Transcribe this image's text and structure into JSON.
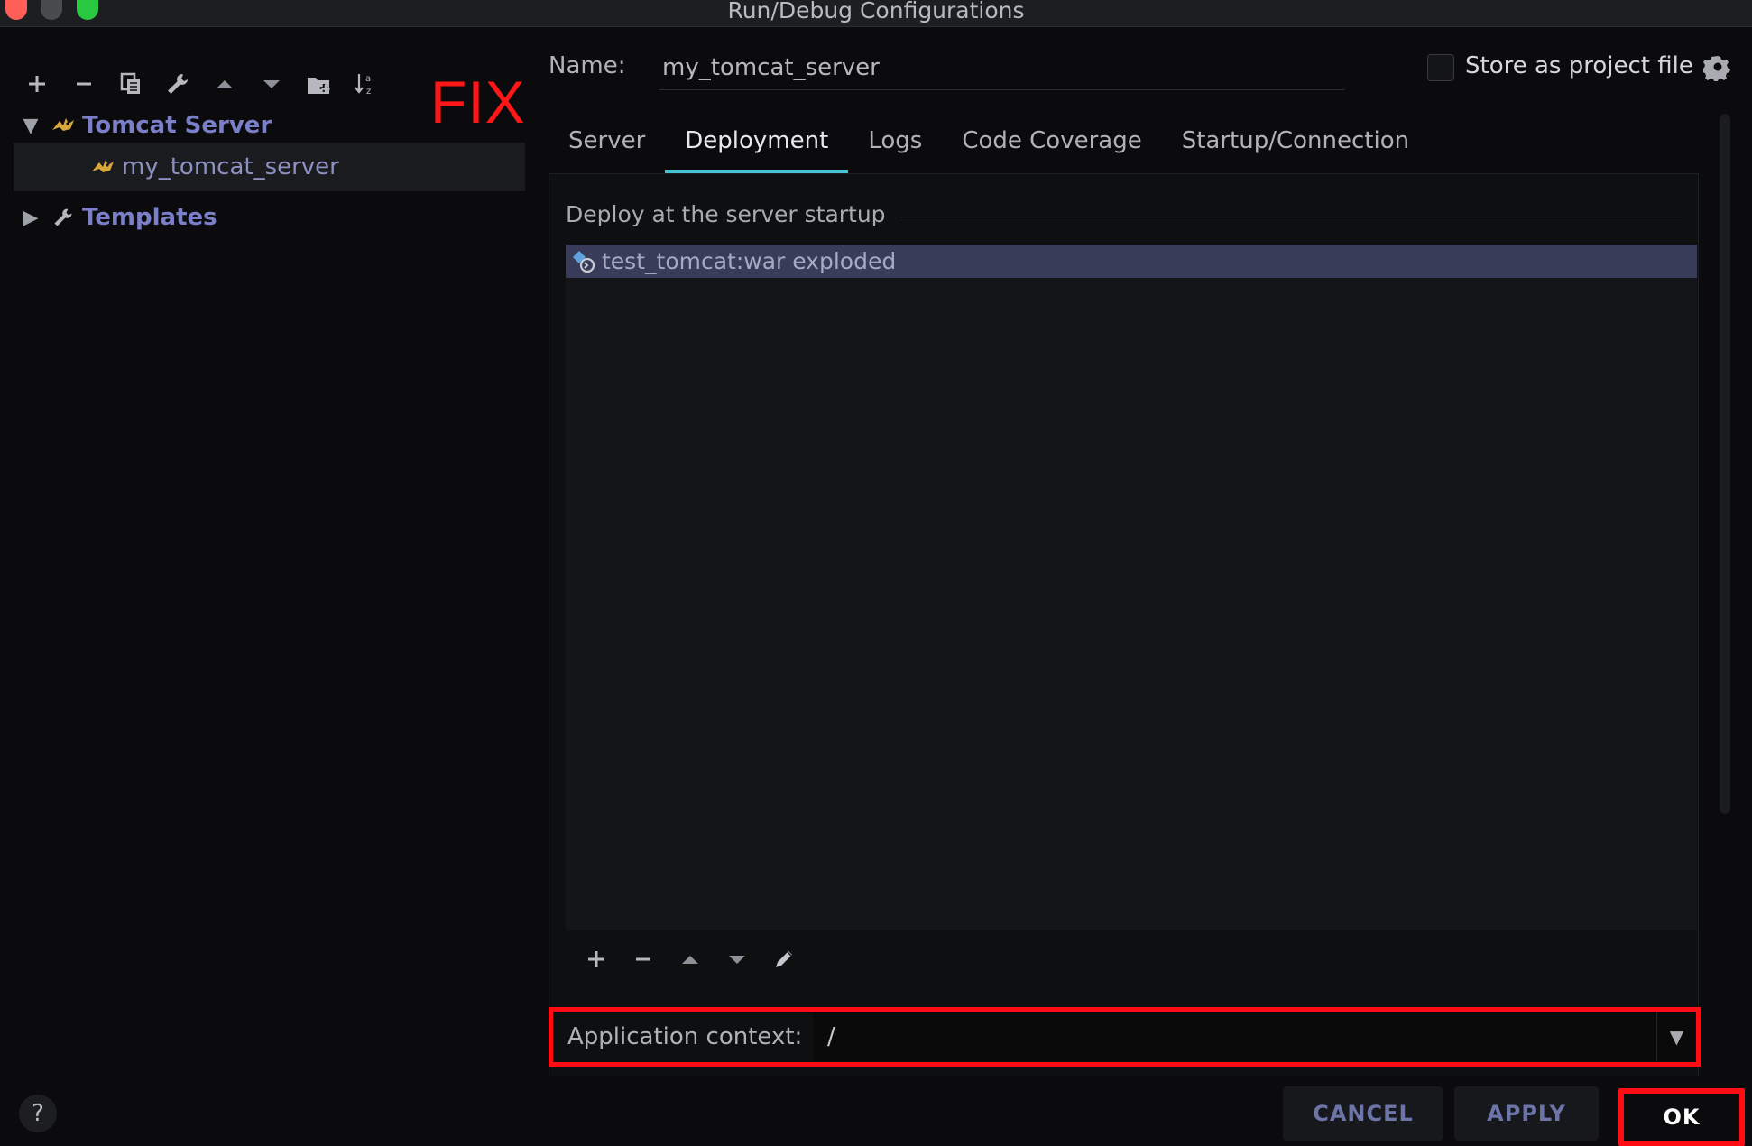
{
  "window": {
    "title": "Run/Debug Configurations"
  },
  "left_toolbar": {
    "icons": [
      "add-icon",
      "remove-icon",
      "copy-icon",
      "wrench-icon",
      "move-up-icon",
      "move-down-icon",
      "new-folder-icon",
      "sort-az-icon"
    ]
  },
  "annotation": {
    "fix_label": "FIX"
  },
  "tree": {
    "group_label": "Tomcat Server",
    "item_label": "my_tomcat_server",
    "templates_label": "Templates"
  },
  "config": {
    "name_label": "Name:",
    "name_value": "my_tomcat_server",
    "store_label": "Store as project file"
  },
  "tabs": [
    "Server",
    "Deployment",
    "Logs",
    "Code Coverage",
    "Startup/Connection"
  ],
  "deployment": {
    "section_title": "Deploy at the server startup",
    "items": [
      "test_tomcat:war exploded"
    ]
  },
  "app_context": {
    "label": "Application context:",
    "value": "/"
  },
  "buttons": {
    "cancel": "CANCEL",
    "apply": "APPLY",
    "ok": "OK",
    "help": "?"
  },
  "colors": {
    "accent_tab": "#47c2d6",
    "highlight_red": "#ff0d14",
    "selection": "#383c58"
  }
}
